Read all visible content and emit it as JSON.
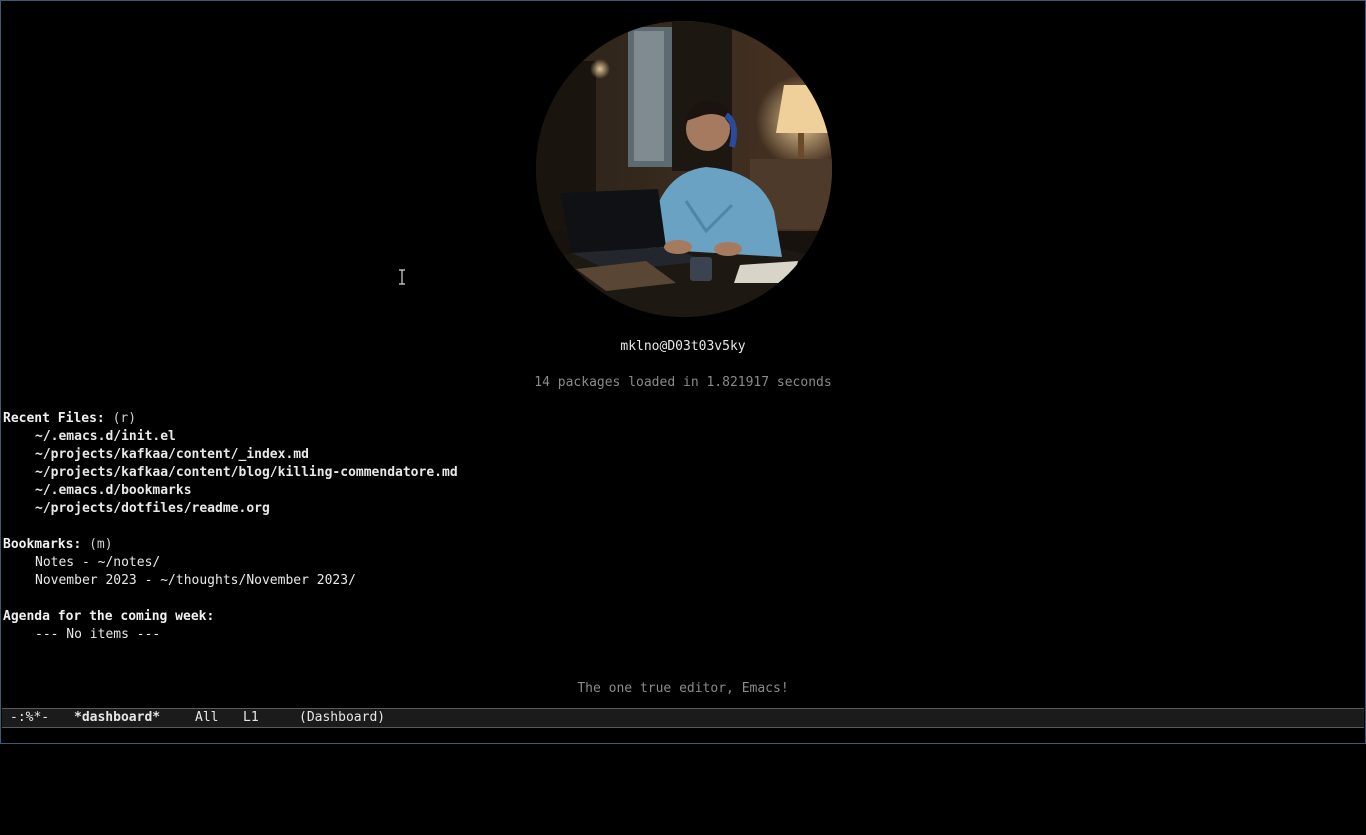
{
  "dashboard": {
    "banner_icon": "photo-person-with-laptop-at-night",
    "user_host": "mklno@D03t03v5ky",
    "init_info": "14 packages loaded in 1.821917 seconds",
    "footer": "The one true editor, Emacs!"
  },
  "recent_files": {
    "heading": "Recent Files:",
    "shortcut": "(r)",
    "items": [
      "~/.emacs.d/init.el",
      "~/projects/kafkaa/content/_index.md",
      "~/projects/kafkaa/content/blog/killing-commendatore.md",
      "~/.emacs.d/bookmarks",
      "~/projects/dotfiles/readme.org"
    ]
  },
  "bookmarks": {
    "heading": "Bookmarks:",
    "shortcut": "(m)",
    "items": [
      "Notes - ~/notes/",
      "November 2023 - ~/thoughts/November 2023/"
    ]
  },
  "agenda": {
    "heading": "Agenda for the coming week:",
    "items": [
      "--- No items ---"
    ]
  },
  "modeline": {
    "status": "-:%*-",
    "buffer_name": "*dashboard*",
    "position": "All",
    "line": "L1",
    "mode": "(Dashboard)"
  },
  "colors": {
    "background": "#000000",
    "foreground": "#e8e8e8",
    "dim": "#8a8a8a",
    "frame_border": "#3a5a7a"
  }
}
